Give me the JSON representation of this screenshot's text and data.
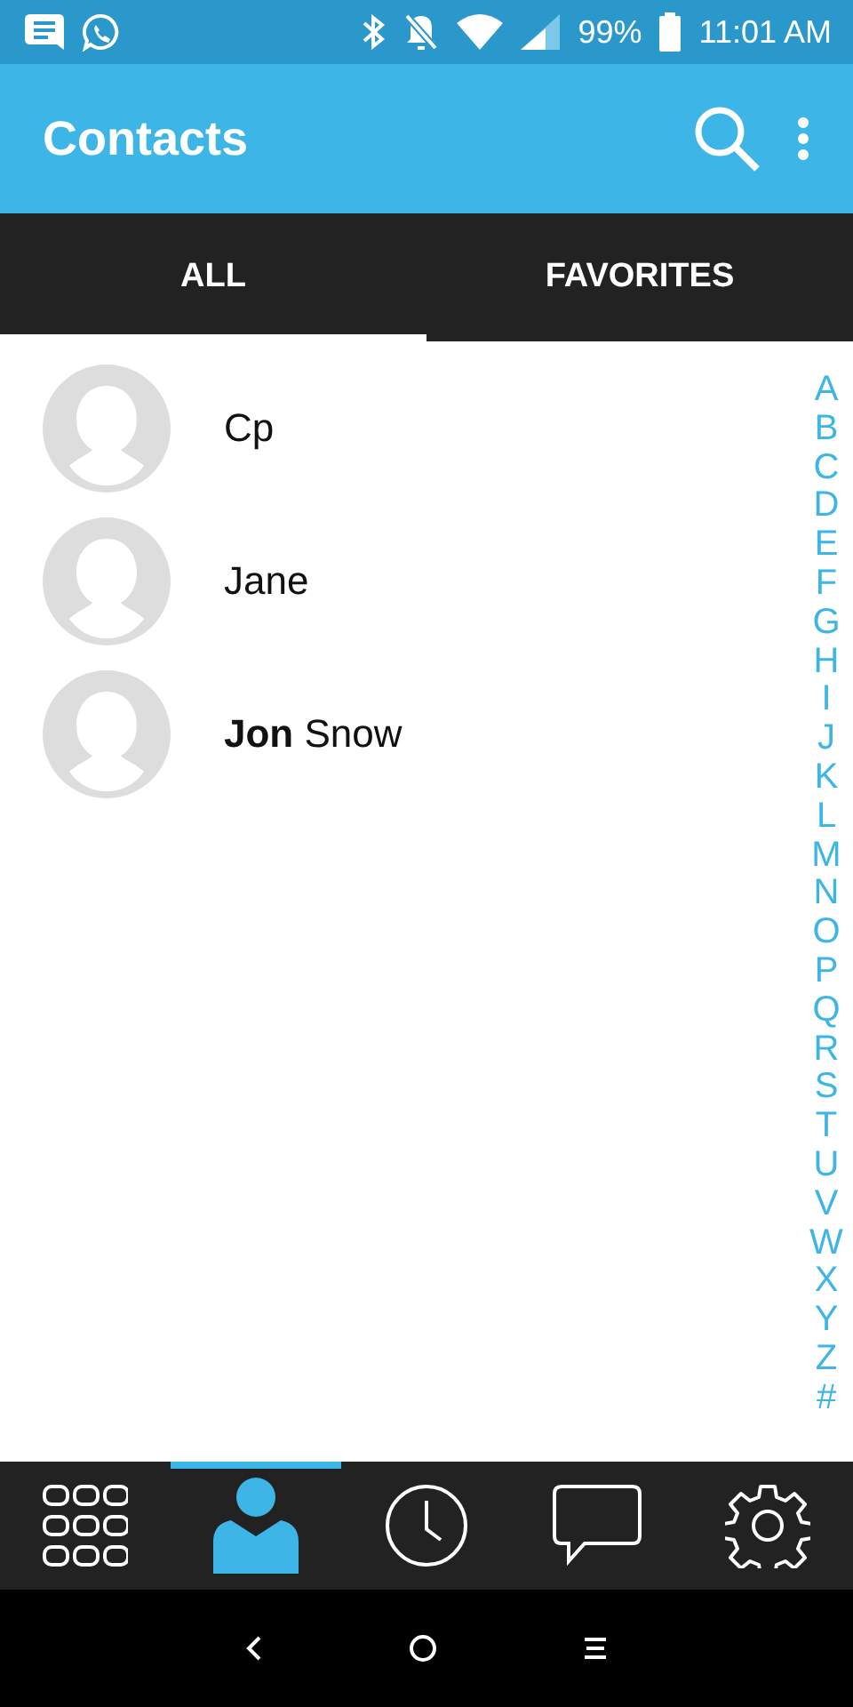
{
  "status_bar": {
    "battery": "99%",
    "time": "11:01 AM"
  },
  "app_bar": {
    "title": "Contacts"
  },
  "tabs": [
    {
      "label": "ALL",
      "selected": true
    },
    {
      "label": "FAVORITES",
      "selected": false
    }
  ],
  "contacts": [
    {
      "name": "Cp"
    },
    {
      "name": "Jane"
    },
    {
      "name": "**Jon** Snow"
    }
  ],
  "index_letters": [
    "A",
    "B",
    "C",
    "D",
    "E",
    "F",
    "G",
    "H",
    "I",
    "J",
    "K",
    "L",
    "M",
    "N",
    "O",
    "P",
    "Q",
    "R",
    "S",
    "T",
    "U",
    "V",
    "W",
    "X",
    "Y",
    "Z",
    "#"
  ],
  "bottom_nav": [
    {
      "kind": "dialpad",
      "selected": false
    },
    {
      "kind": "contacts",
      "selected": true
    },
    {
      "kind": "history",
      "selected": false
    },
    {
      "kind": "messages",
      "selected": false
    },
    {
      "kind": "settings",
      "selected": false
    }
  ]
}
